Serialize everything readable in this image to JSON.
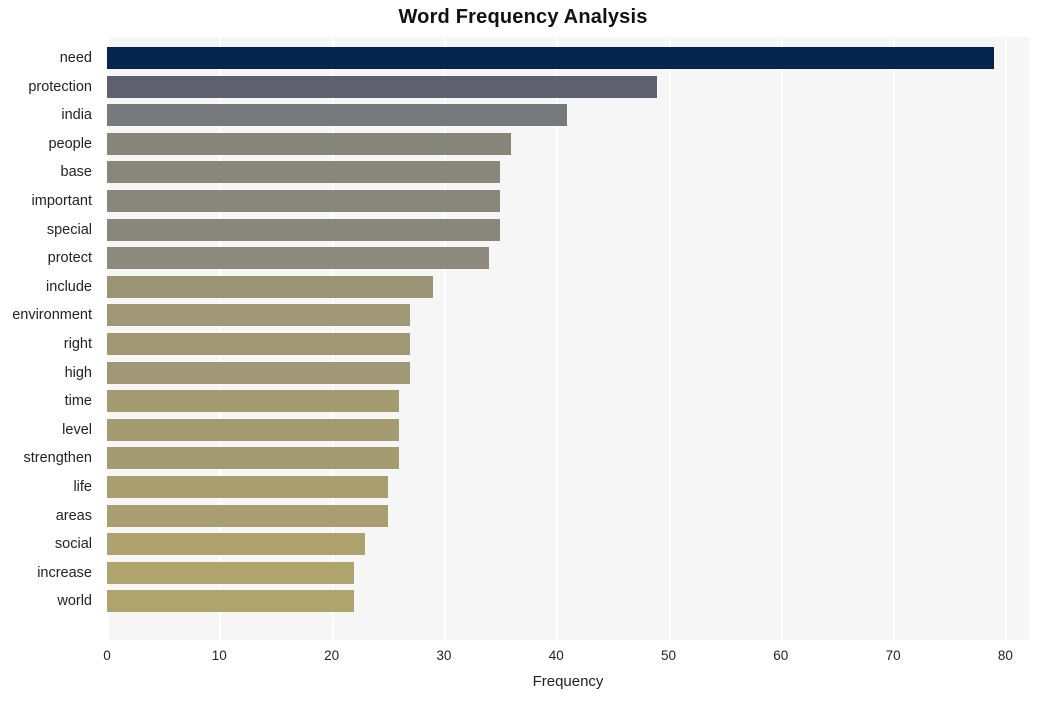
{
  "chart_data": {
    "type": "bar",
    "orientation": "horizontal",
    "title": "Word Frequency Analysis",
    "xlabel": "Frequency",
    "ylabel": "",
    "xlim": [
      0,
      80
    ],
    "xticks": [
      0,
      10,
      20,
      30,
      40,
      50,
      60,
      70,
      80
    ],
    "grid": true,
    "legend": null,
    "categories": [
      "need",
      "protection",
      "india",
      "people",
      "base",
      "important",
      "special",
      "protect",
      "include",
      "environment",
      "right",
      "high",
      "time",
      "level",
      "strengthen",
      "life",
      "areas",
      "social",
      "increase",
      "world"
    ],
    "values": [
      79,
      49,
      41,
      36,
      35,
      35,
      35,
      34,
      29,
      27,
      27,
      27,
      26,
      26,
      26,
      25,
      25,
      23,
      22,
      22
    ],
    "bar_colors": [
      "#04254e",
      "#5f6170",
      "#77787a",
      "#85857a",
      "#88877b",
      "#88877b",
      "#88877b",
      "#8b8a7c",
      "#9b9474",
      "#a09874",
      "#a09874",
      "#a09874",
      "#a59b71",
      "#a59b71",
      "#a59b71",
      "#a89e70",
      "#a89e70",
      "#ad a16e",
      "#b0a46d",
      "#b0a46d"
    ],
    "plot_background": "#f6f6f7",
    "grid_color": "#ffffff",
    "figure_background": "#ffffff"
  },
  "axes": {
    "x_tick_labels": [
      "0",
      "10",
      "20",
      "30",
      "40",
      "50",
      "60",
      "70",
      "80"
    ]
  }
}
